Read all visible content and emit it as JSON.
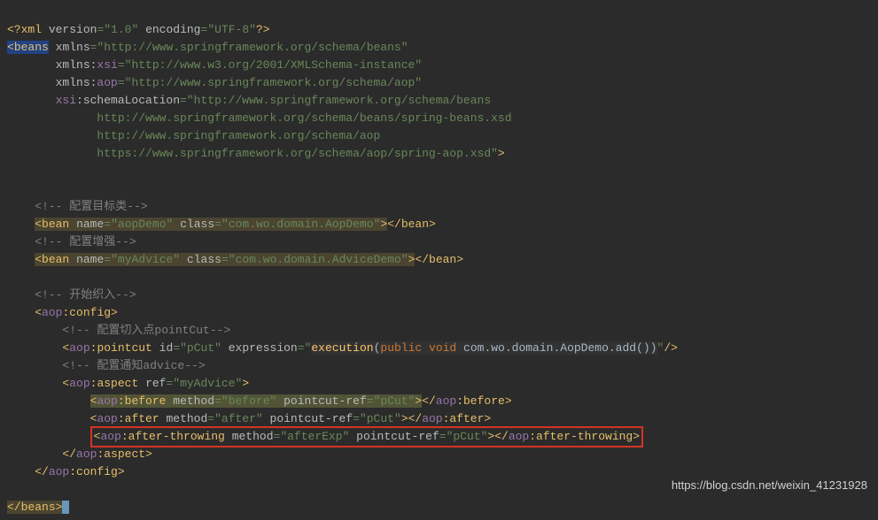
{
  "xml_decl": {
    "version_attr": "version",
    "version_val": "\"1.0\"",
    "encoding_attr": "encoding",
    "encoding_val": "\"UTF-8\""
  },
  "beans_open": {
    "tag": "beans",
    "xmlns_attr": "xmlns",
    "xmlns_val": "\"http://www.springframework.org/schema/beans\"",
    "xsi_prefix": "xmlns:",
    "xsi_name": "xsi",
    "xsi_val": "\"http://www.w3.org/2001/XMLSchema-instance\"",
    "aop_prefix": "xmlns:",
    "aop_name": "aop",
    "aop_val": "\"http://www.springframework.org/schema/aop\"",
    "sl_prefix": "xsi",
    "sl_name": ":schemaLocation",
    "sl_val1": "\"http://www.springframework.org/schema/beans",
    "sl_val2": "http://www.springframework.org/schema/beans/spring-beans.xsd",
    "sl_val3": "http://www.springframework.org/schema/aop",
    "sl_val4": "https://www.springframework.org/schema/aop/spring-aop.xsd\""
  },
  "comment1": "<!-- 配置目标类-->",
  "bean1": {
    "tag_open": "bean",
    "name_attr": "name",
    "name_val": "\"aopDemo\"",
    "class_attr": "class",
    "class_val": "\"com.wo.domain.AopDemo\"",
    "close": "bean"
  },
  "comment2": "<!-- 配置增强-->",
  "bean2": {
    "tag_open": "bean",
    "name_attr": "name",
    "name_val": "\"myAdvice\"",
    "class_attr": "class",
    "class_val": "\"com.wo.domain.AdviceDemo\"",
    "close": "bean"
  },
  "comment3": "<!-- 开始织入-->",
  "aop_config_open": {
    "ns": "aop",
    "tag": ":config"
  },
  "comment4": "<!-- 配置切入点pointCut-->",
  "pointcut": {
    "ns": "aop",
    "tag": ":pointcut",
    "id_attr": "id",
    "id_val": "\"pCut\"",
    "expr_attr": "expression",
    "expr_exec": "execution",
    "expr_lparen": "(",
    "expr_public": "public",
    "expr_void": "void",
    "expr_rest": "com.wo.domain.AopDemo.add()",
    "expr_rparen": ")"
  },
  "comment5": "<!-- 配置通知advice-->",
  "aspect": {
    "ns": "aop",
    "tag": ":aspect",
    "ref_attr": "ref",
    "ref_val": "\"myAdvice\""
  },
  "before": {
    "ns": "aop",
    "tag": ":before",
    "method_attr": "method",
    "method_val": "\"before\"",
    "pc_attr": "pointcut-ref",
    "pc_val": "\"pCut\"",
    "close_ns": "aop",
    "close_tag": ":before"
  },
  "after": {
    "ns": "aop",
    "tag": ":after",
    "method_attr": "method",
    "method_val": "\"after\"",
    "pc_attr": "pointcut-ref",
    "pc_val": "\"pCut\"",
    "close_ns": "aop",
    "close_tag": ":after"
  },
  "after_throwing": {
    "ns": "aop",
    "tag": ":after-throwing",
    "method_attr": "method",
    "method_val": "\"afterExp\"",
    "pc_attr": "pointcut-ref",
    "pc_val": "\"pCut\"",
    "close_ns": "aop",
    "close_tag": ":after-throwing"
  },
  "aspect_close": {
    "ns": "aop",
    "tag": ":aspect"
  },
  "config_close": {
    "ns": "aop",
    "tag": ":config"
  },
  "beans_close": "beans",
  "watermark": "https://blog.csdn.net/weixin_41231928"
}
